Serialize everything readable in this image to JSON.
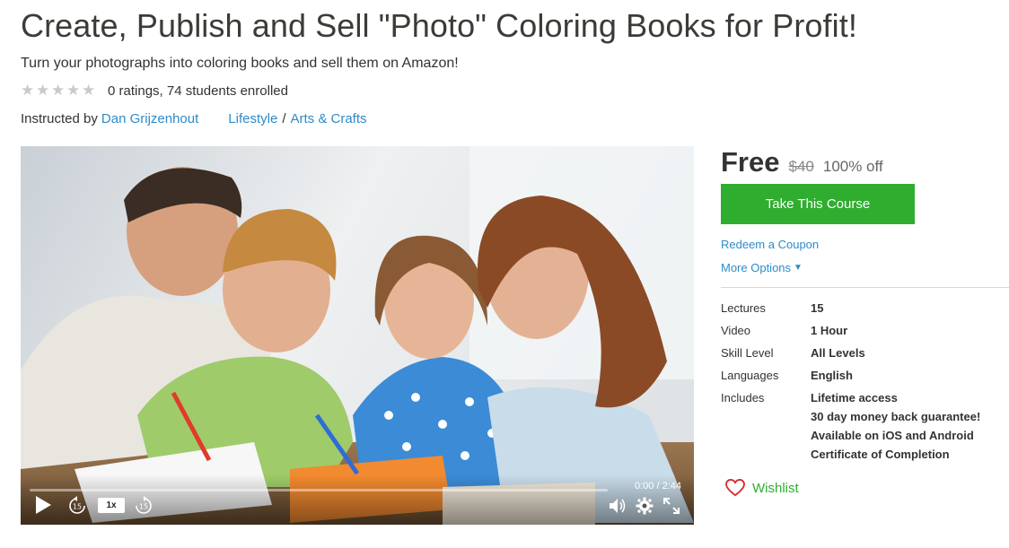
{
  "course": {
    "title": "Create, Publish and Sell \"Photo\" Coloring Books for Profit!",
    "subtitle": "Turn your photographs into coloring books and sell them on Amazon!",
    "rating_text": "0 ratings, 74 students enrolled",
    "stars_filled": 0,
    "stars_total": 5,
    "instructed_by_label": "Instructed by",
    "instructor": "Dan Grijzenhout",
    "category": "Lifestyle",
    "category_sep": "/",
    "subcategory": "Arts & Crafts"
  },
  "video": {
    "time_current": "0:00",
    "time_sep": "/",
    "time_total": "2:44",
    "progress": 0,
    "speed": "1x",
    "rewind_seconds": "15",
    "forward_seconds": "15",
    "icons": [
      "play-icon",
      "rewind-15-icon",
      "forward-15-icon",
      "volume-icon",
      "settings-gear-icon",
      "fullscreen-icon"
    ]
  },
  "pricing": {
    "price": "Free",
    "original_price": "$40",
    "discount": "100% off",
    "cta_label": "Take This Course",
    "redeem_label": "Redeem a Coupon",
    "more_options_label": "More Options",
    "cta_color": "#2fad2f",
    "link_color": "#2e8bc9"
  },
  "details": [
    {
      "label": "Lectures",
      "value": "15"
    },
    {
      "label": "Video",
      "value": "1 Hour"
    },
    {
      "label": "Skill Level",
      "value": "All Levels"
    },
    {
      "label": "Languages",
      "value": "English"
    }
  ],
  "includes": {
    "label": "Includes",
    "items": [
      "Lifetime access",
      "30 day money back guarantee!",
      "Available on iOS and Android",
      "Certificate of Completion"
    ]
  },
  "wishlist": {
    "label": "Wishlist",
    "icon": "heart-icon",
    "color": "#2fad2f"
  }
}
